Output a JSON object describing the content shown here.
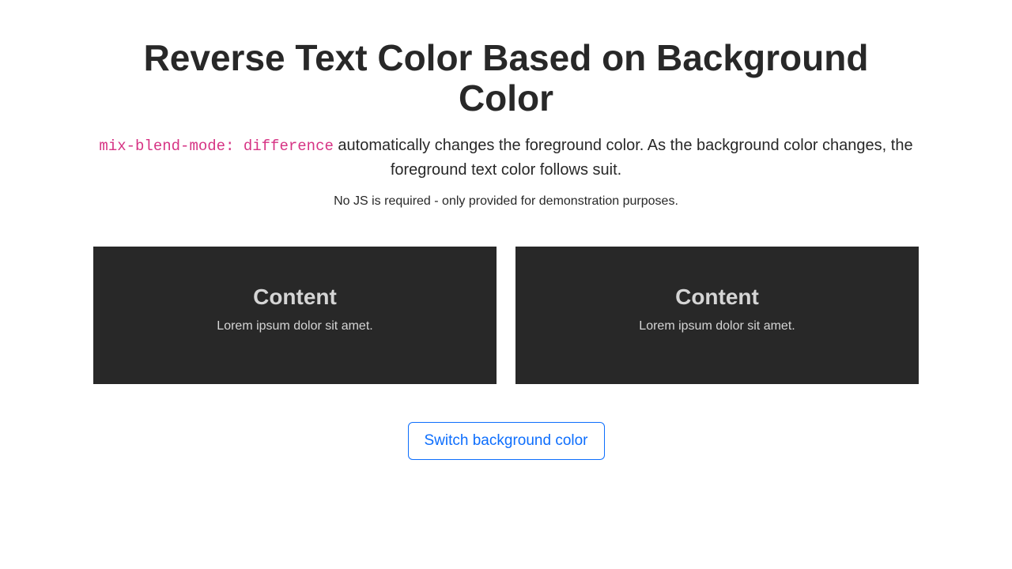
{
  "header": {
    "title": "Reverse Text Color Based on Background Color",
    "code": "mix-blend-mode: difference",
    "subtitle_rest": " automatically changes the foreground color. As the background color changes, the foreground text color follows suit.",
    "note": "No JS is required - only provided for demonstration purposes."
  },
  "cards": [
    {
      "title": "Content",
      "body": "Lorem ipsum dolor sit amet."
    },
    {
      "title": "Content",
      "body": "Lorem ipsum dolor sit amet."
    }
  ],
  "button": {
    "label": "Switch background color"
  }
}
